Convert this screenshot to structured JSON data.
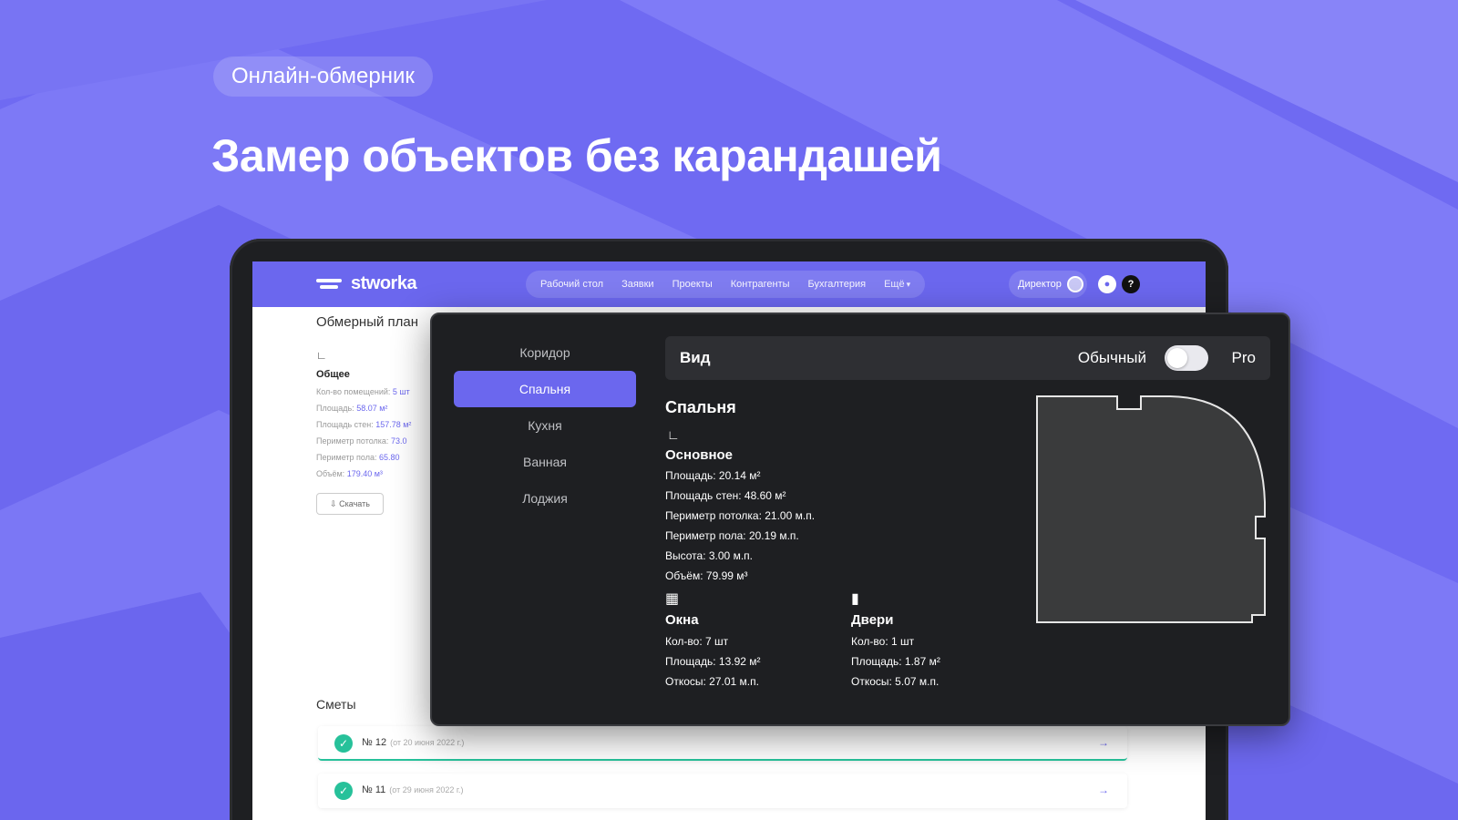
{
  "hero": {
    "badge": "Онлайн-обмерник",
    "headline": "Замер объектов без карандашей"
  },
  "app": {
    "logo_text": "stworka",
    "nav": [
      "Рабочий стол",
      "Заявки",
      "Проекты",
      "Контрагенты",
      "Бухгалтерия",
      "Ещё"
    ],
    "user_role": "Директор",
    "help_glyph": "?",
    "colors": {
      "accent": "#6b67ee",
      "panel_bg": "#1e1f22",
      "success": "#27c19a"
    }
  },
  "page": {
    "title": "Обмерный план",
    "summary_head": "Общее",
    "summary": [
      {
        "label": "Кол-во помещений:",
        "value": "5 шт"
      },
      {
        "label": "Площадь:",
        "value": "58.07 м²"
      },
      {
        "label": "Площадь стен:",
        "value": "157.78 м²"
      },
      {
        "label": "Периметр потолка:",
        "value": "73.0"
      },
      {
        "label": "Периметр пола:",
        "value": "65.80"
      },
      {
        "label": "Объём:",
        "value": "179.40 м³"
      }
    ],
    "edit_button": "Скачать",
    "estimates_title": "Сметы",
    "estimates": [
      {
        "number": "№ 12",
        "date": "(от 20 июня 2022 г.)"
      },
      {
        "number": "№ 11",
        "date": "(от 29 июня 2022 г.)"
      }
    ]
  },
  "panel": {
    "rooms": [
      "Коридор",
      "Спальня",
      "Кухня",
      "Ванная",
      "Лоджия"
    ],
    "active_room": "Спальня",
    "view_label": "Вид",
    "mode_normal": "Обычный",
    "mode_pro": "Pro",
    "room_title": "Спальня",
    "main_head": "Основное",
    "main": [
      "Площадь: 20.14 м²",
      "Площадь стен: 48.60 м²",
      "Периметр потолка: 21.00 м.п.",
      "Периметр пола: 20.19 м.п.",
      "Высота: 3.00 м.п.",
      "Объём: 79.99 м³"
    ],
    "windows": {
      "icon": "window-icon",
      "head": "Окна",
      "lines": [
        "Кол-во: 7 шт",
        "Площадь: 13.92 м²",
        "Откосы: 27.01 м.п."
      ]
    },
    "doors": {
      "icon": "door-icon",
      "head": "Двери",
      "lines": [
        "Кол-во: 1 шт",
        "Площадь: 1.87 м²",
        "Откосы: 5.07 м.п."
      ]
    }
  }
}
